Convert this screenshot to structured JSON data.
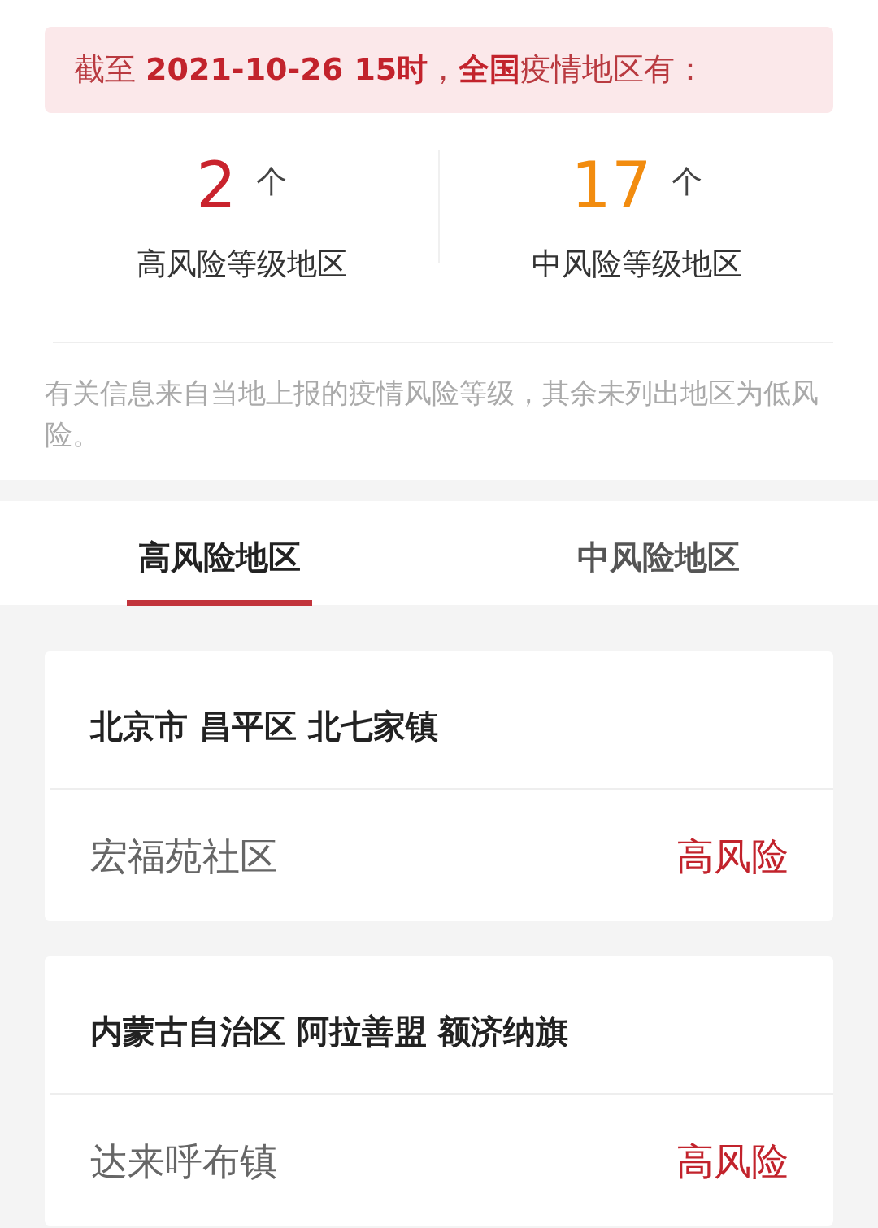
{
  "banner": {
    "text": "截至 **2021-10-26 15时**，**全国**疫情地区有："
  },
  "stats": [
    {
      "count": "2",
      "unit": "个",
      "label": "高风险等级地区",
      "color": "#c9232d"
    },
    {
      "count": "17",
      "unit": "个",
      "label": "中风险等级地区",
      "color": "#f28c0f"
    }
  ],
  "note": "有关信息来自当地上报的疫情风险等级，其余未列出地区为低风险。",
  "tabs": [
    {
      "label": "高风险地区",
      "selected": true
    },
    {
      "label": "中风险地区",
      "selected": false
    }
  ],
  "areas": [
    {
      "region": "北京市 昌平区 北七家镇",
      "places": [
        {
          "name": "宏福苑社区",
          "risk": "高风险"
        }
      ]
    },
    {
      "region": "内蒙古自治区 阿拉善盟 额济纳旗",
      "places": [
        {
          "name": "达来呼布镇",
          "risk": "高风险"
        }
      ]
    }
  ]
}
